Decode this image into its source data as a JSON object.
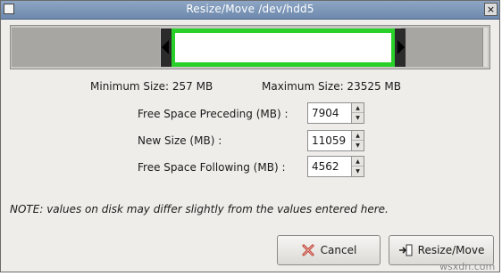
{
  "window": {
    "title": "Resize/Move /dev/hdd5",
    "close_glyph": "×",
    "window_icon": "window-icon"
  },
  "resizer": {
    "free_preceding_fraction": 0.336,
    "partition_fraction": 0.47,
    "free_following_fraction": 0.194,
    "partition_color": "#2ad02a",
    "free_color": "#a8a6a3"
  },
  "sizes": {
    "minimum": "Minimum Size: 257 MB",
    "maximum": "Maximum Size: 23525 MB"
  },
  "form": {
    "preceding": {
      "label": "Free Space Preceding (MB) :",
      "value": "7904"
    },
    "new_size": {
      "label": "New Size (MB) :",
      "value": "11059"
    },
    "following": {
      "label": "Free Space Following (MB) :",
      "value": "4562"
    }
  },
  "note": "NOTE: values on disk may differ slightly from the values entered here.",
  "buttons": {
    "cancel": {
      "label": "Cancel",
      "icon": "cancel-x-icon",
      "accent": "#c0392b"
    },
    "resize": {
      "label": "Resize/Move",
      "icon": "resize-move-icon"
    }
  },
  "watermark": "wsxdn.com"
}
